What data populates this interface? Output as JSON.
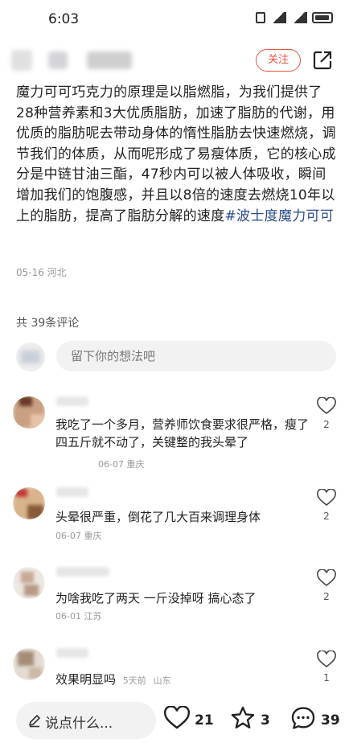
{
  "status_bar": {
    "time": "6:03"
  },
  "header": {
    "follow_label": "关注"
  },
  "post": {
    "body": "魔力可可巧克力的原理是以脂燃脂，为我们提供了28种营养素和3大优质脂肪，加速了脂肪的代谢，用优质的脂肪呢去带动身体的惰性脂肪去快速燃烧，调节我们的体质，从而呢形成了易瘦体质，它的核心成分是中链甘油三酯，47秒内可以被人体吸收，瞬间增加我们的饱腹感，并且以8倍的速度去燃烧10年以上的脂肪，提高了脂肪分解的速度",
    "hashtag": "#波士度魔力可可",
    "meta": "05-16 河北"
  },
  "comments_header": "共 39条评论",
  "comment_input": {
    "placeholder": "留下你的想法吧"
  },
  "comments": [
    {
      "text": "我吃了一个多月，营养师饮食要求很严格，瘦了四五斤就不动了，关键整的我头晕了",
      "meta": "06-07 重庆",
      "likes": "2"
    },
    {
      "text": "头晕很严重，倒花了几大百来调理身体",
      "meta": "06-07 重庆",
      "likes": "2"
    },
    {
      "text": "为啥我吃了两天 一斤没掉呀 搞心态了",
      "meta": "06-01 江苏",
      "likes": "2"
    },
    {
      "text": "效果明显吗",
      "time": "5天前",
      "location": "山东",
      "likes": "1"
    }
  ],
  "bottom_bar": {
    "say_label": "说点什么...",
    "likes": "21",
    "favorites": "3",
    "comments": "39"
  },
  "colors": {
    "accent": "#e5533d",
    "hashtag": "#2b4b8a"
  }
}
